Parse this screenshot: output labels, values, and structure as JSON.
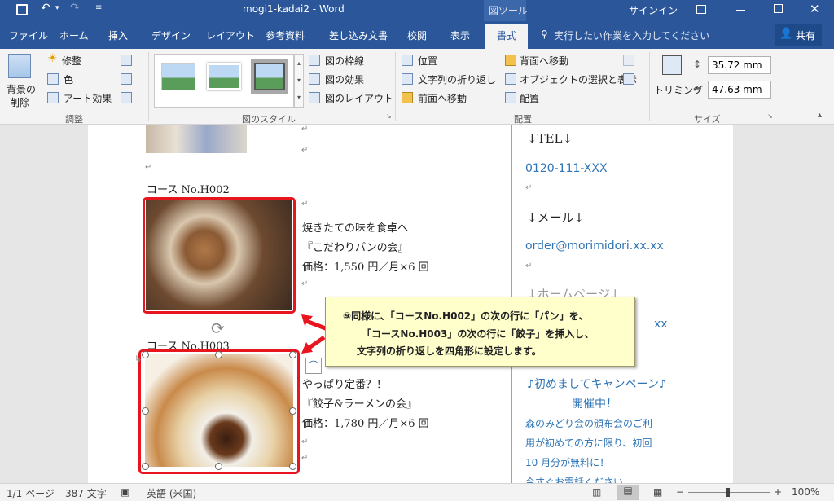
{
  "titlebar": {
    "doc_title": "mogi1-kadai2  -  Word",
    "tool_context": "図ツール",
    "signin": "サインイン"
  },
  "tabs": [
    "ファイル",
    "ホーム",
    "挿入",
    "デザイン",
    "レイアウト",
    "参考資料",
    "差し込み文書",
    "校閲",
    "表示",
    "書式"
  ],
  "tell_me": "実行したい作業を入力してください",
  "share": "共有",
  "ribbon": {
    "adjust": {
      "remove_bg_1": "背景の",
      "remove_bg_2": "削除",
      "corrections": "修整",
      "color": "色",
      "artistic": "アート効果",
      "group": "調整"
    },
    "styles": {
      "border": "図の枠線",
      "effects": "図の効果",
      "layout": "図のレイアウト",
      "group": "図のスタイル"
    },
    "arrange": {
      "position": "位置",
      "wrap": "文字列の折り返し",
      "forward": "前面へ移動",
      "backward": "背面へ移動",
      "selection": "オブジェクトの選択と表示",
      "align": "配置",
      "group": "配置"
    },
    "size": {
      "crop": "トリミング",
      "height": "35.72 mm",
      "width": "47.63 mm",
      "group": "サイズ"
    }
  },
  "document": {
    "course2_title": "コース No.H002",
    "course2_line1": "焼きたての味を食卓へ",
    "course2_line2": "『こだわりパンの会』",
    "course2_line3": "価格：1,550 円／月×6 回",
    "course3_title": "コース No.H003",
    "course3_line1": "やっぱり定番？！",
    "course3_line2": "『餃子&ラーメンの会』",
    "course3_line3": "価格：1,780 円／月×6 回",
    "tel_heading": "↓TEL↓",
    "tel": "0120-111-XXX",
    "mail_heading": "↓メール↓",
    "mail": "order@morimidori.xx.xx",
    "hp_heading": "↓ホームページ↓",
    "hp_tail": "xx",
    "campaign1": "♪初めましてキャンペーン♪",
    "campaign2": "開催中！",
    "campaign_body1": "森のみどり会の頒布会のご利",
    "campaign_body2": "用が初めての方に限り、初回",
    "campaign_body3": "10 月分が無料に！",
    "campaign_body4": "今すぐお電話ください。"
  },
  "callout": {
    "line1": "⑨同様に、「コースNo.H002」の次の行に「パン」を、",
    "line2": "「コースNo.H003」の次の行に「餃子」を挿入し、",
    "line3": "文字列の折り返しを四角形に設定します。"
  },
  "statusbar": {
    "page": "1/1 ページ",
    "words": "387 文字",
    "language": "英語 (米国)",
    "zoom": "100%"
  },
  "colors": {
    "accent": "#2b579a",
    "highlight_border": "#e8141e",
    "link_text": "#2e74b5",
    "callout_bg": "#ffffcc"
  }
}
